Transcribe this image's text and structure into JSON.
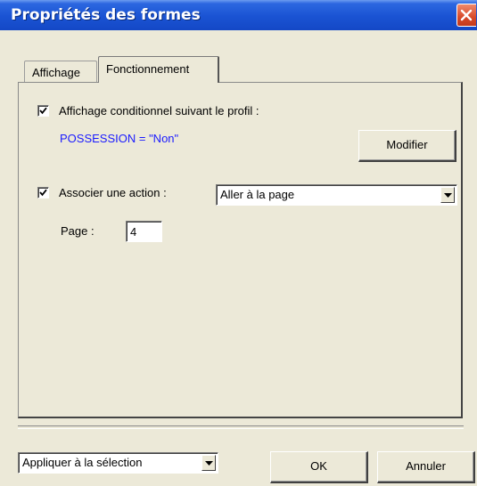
{
  "window": {
    "title": "Propriétés des formes",
    "titlebar_color": "#1a53d3",
    "close_icon": "close-icon"
  },
  "tabs": [
    {
      "label": "Affichage",
      "active": false
    },
    {
      "label": "Fonctionnement",
      "active": true
    }
  ],
  "conditional": {
    "checked": true,
    "label": "Affichage conditionnel suivant le profil :",
    "condition": "POSSESSION = \"Non\"",
    "condition_color": "#1a1aff",
    "modify_label": "Modifier"
  },
  "action": {
    "checked": true,
    "label": "Associer une action :",
    "selected": "Aller à la page",
    "page_label": "Page :",
    "page_value": "4"
  },
  "footer": {
    "scope_selected": "Appliquer à la sélection",
    "ok_label": "OK",
    "cancel_label": "Annuler"
  }
}
